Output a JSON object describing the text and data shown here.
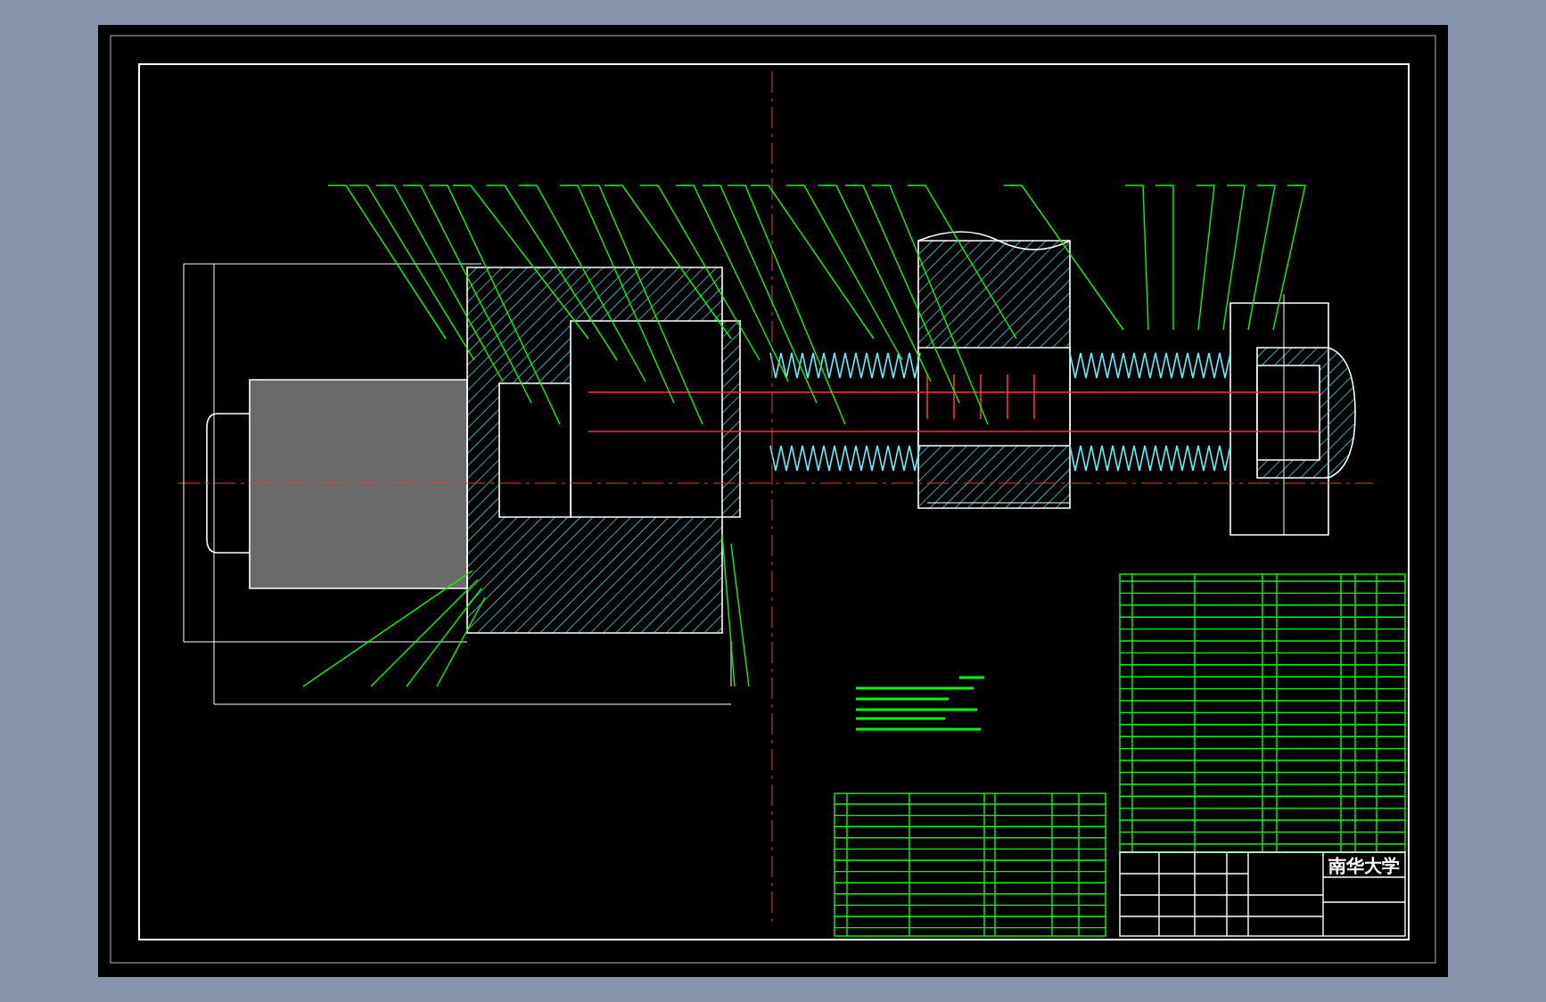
{
  "title_block": {
    "school": "南华大学"
  }
}
